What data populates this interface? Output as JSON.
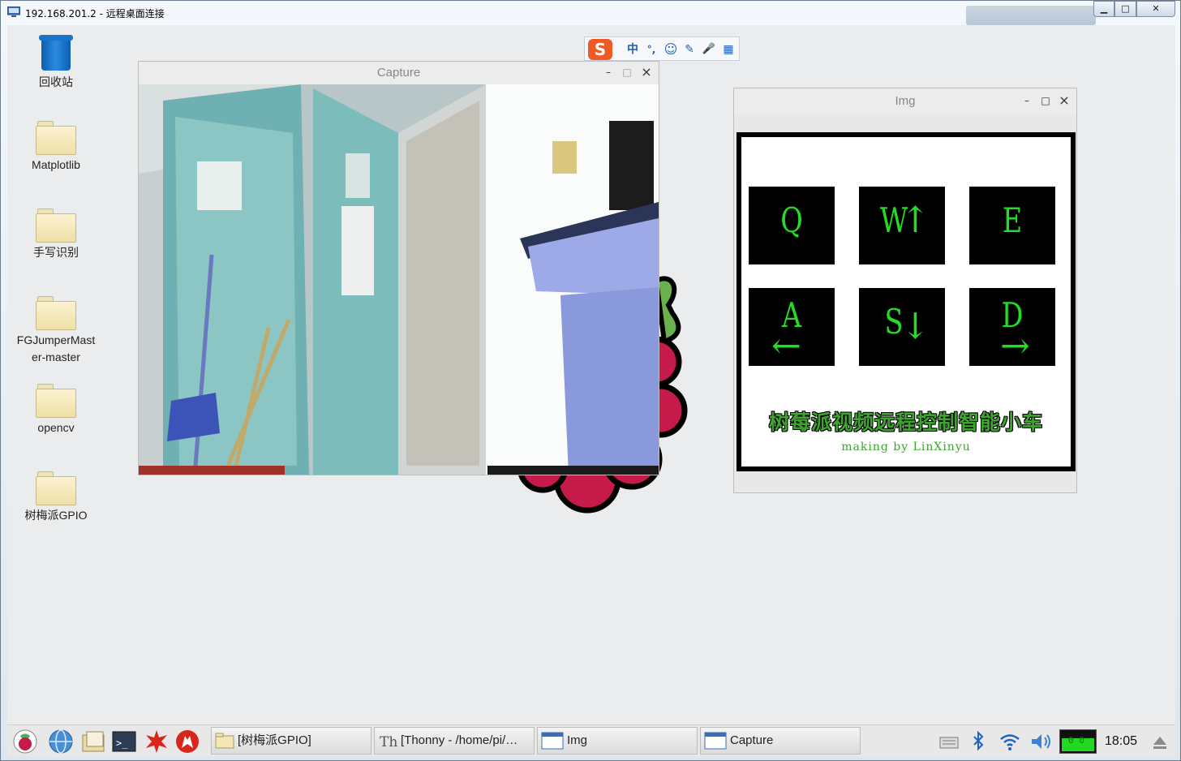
{
  "rdp": {
    "title": "192.168.201.2 - 远程桌面连接",
    "min": "▁",
    "max": "□",
    "close": "✕"
  },
  "desktop_icons": [
    {
      "label": "回收站",
      "icon": "trash-icon"
    },
    {
      "label": "Matplotlib",
      "icon": "folder-icon"
    },
    {
      "label": "手写识别",
      "icon": "folder-icon"
    },
    {
      "label": "FGJumperMaster-master",
      "icon": "folder-icon"
    },
    {
      "label": "opencv",
      "icon": "folder-icon"
    },
    {
      "label": "树梅派GPIO",
      "icon": "folder-icon"
    }
  ],
  "capture_window": {
    "title": "Capture",
    "min": "–",
    "max": "□",
    "close": "×"
  },
  "img_window": {
    "title": "Img",
    "min": "–",
    "max": "□",
    "close": "×",
    "keys": [
      {
        "char": "Q",
        "arrow": ""
      },
      {
        "char": "W",
        "arrow": "↑"
      },
      {
        "char": "E",
        "arrow": ""
      },
      {
        "char": "A",
        "arrow": "←"
      },
      {
        "char": "S",
        "arrow": "↓"
      },
      {
        "char": "D",
        "arrow": "→"
      }
    ],
    "heading": "树莓派视频远程控制智能小车",
    "credit": "making by LinXinyu"
  },
  "ime": {
    "logo": "S",
    "mode": "中",
    "punct": "°,",
    "emoji": "☺",
    "skin": "✎",
    "mic": "🎤",
    "apps": "▦"
  },
  "taskbar": {
    "tasks": [
      {
        "label": "[树梅派GPIO]",
        "icon": "folder-icon"
      },
      {
        "label": "[Thonny  -  /home/pi/…",
        "icon": "thonny-icon"
      },
      {
        "label": "Img",
        "icon": "window-icon"
      },
      {
        "label": "Capture",
        "icon": "window-icon"
      }
    ],
    "clock": "18:05",
    "cpu_label": "0 0"
  },
  "colors": {
    "key_text": "#22dd22",
    "heading": "#3da52e",
    "ime_logo": "#ef5a24"
  }
}
